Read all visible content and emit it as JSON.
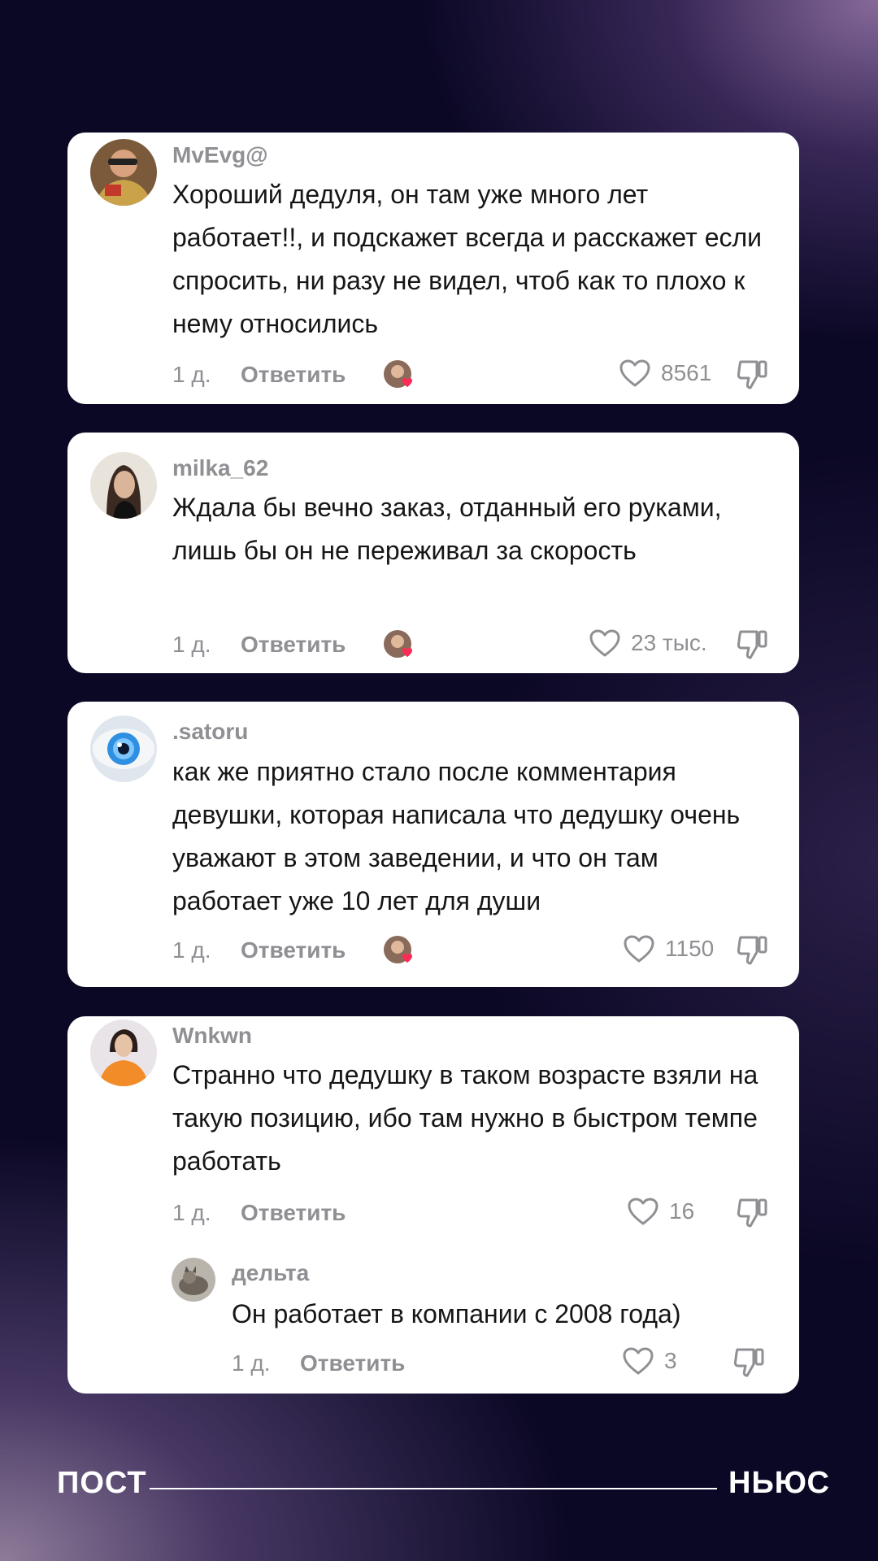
{
  "comments": [
    {
      "username": "MvEvg@",
      "text": "Хороший дедуля, он там уже много лет работает!!, и подскажет всегда и расскажет если спросить, ни разу не видел, чтоб как то плохо к нему относились",
      "time": "1 д.",
      "reply_label": "Ответить",
      "likes": "8561"
    },
    {
      "username": "milka_62",
      "text": "Ждала бы вечно заказ, отданный его руками, лишь бы он не переживал за скорость",
      "time": "1 д.",
      "reply_label": "Ответить",
      "likes": "23 тыс."
    },
    {
      "username": ".satoru",
      "text": "как же приятно стало после комментария девушки, которая написала что дедушку очень уважают в этом заведении, и что он там работает уже 10 лет для души",
      "time": "1 д.",
      "reply_label": "Ответить",
      "likes": "1150"
    },
    {
      "username": "Wnkwn",
      "text": "Странно что дедушку в таком возрасте взяли на такую позицию, ибо там нужно в быстром темпе работать",
      "time": "1 д.",
      "reply_label": "Ответить",
      "likes": "16",
      "reply": {
        "username": "дельта",
        "text": "Он работает в компании с 2008 года)",
        "time": "1 д.",
        "reply_label": "Ответить",
        "likes": "3"
      }
    }
  ],
  "footer": {
    "left": "ПОСТ",
    "right": "НЬЮС"
  },
  "colors": {
    "accent_heart": "#fe2c55",
    "meta_gray": "#8f8f94",
    "text": "#161616"
  }
}
